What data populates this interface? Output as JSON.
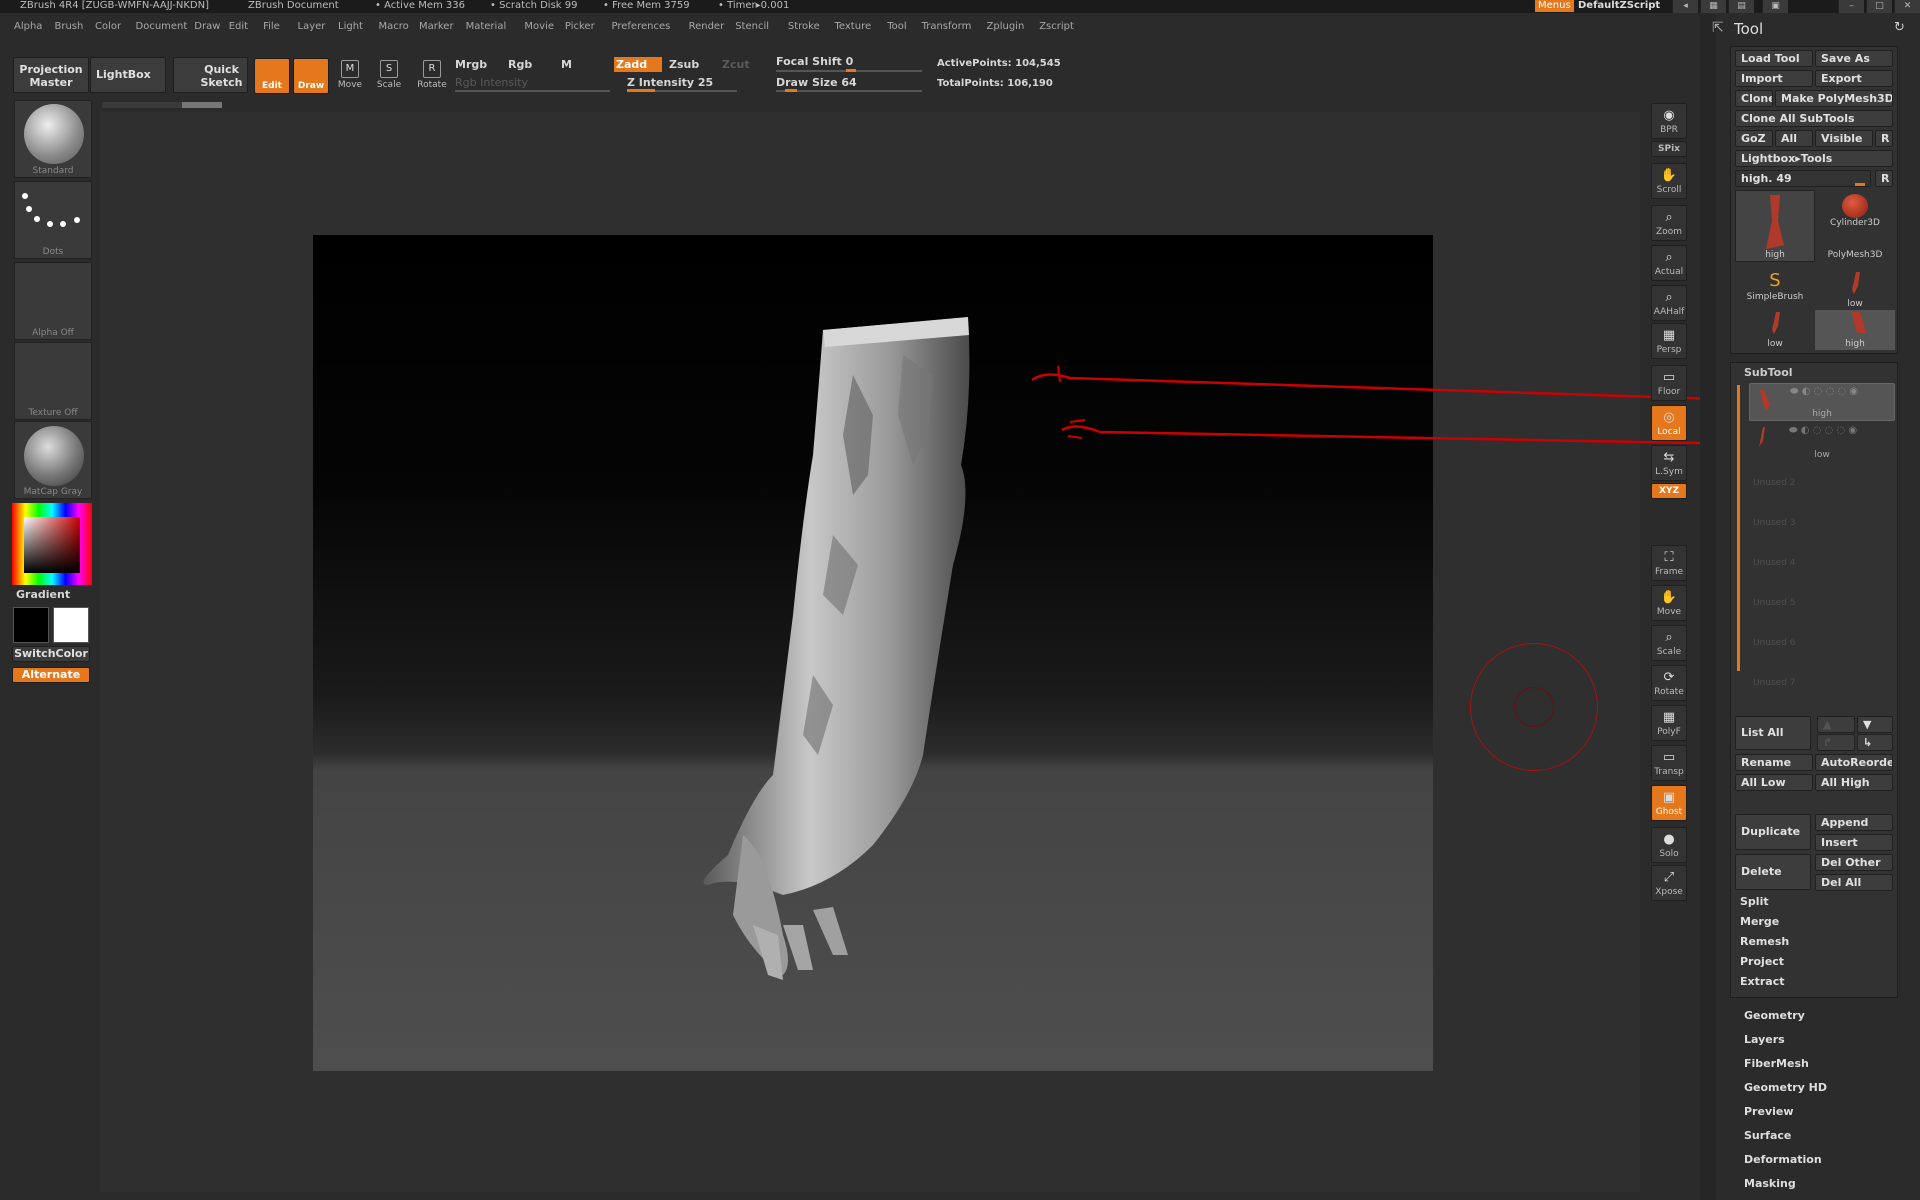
{
  "titlebar": {
    "app": "ZBrush 4R4 [ZUGB-WMFN-AAJJ-NKDN]",
    "document": "ZBrush Document",
    "active_mem": "• Active Mem 336",
    "scratch_disk": "• Scratch Disk 99",
    "free_mem": "• Free Mem 3759",
    "timer": "• Timer▸0.001",
    "menus_btn": "Menus",
    "script": "DefaultZScript"
  },
  "menubar": [
    "Alpha",
    "Brush",
    "Color",
    "Document",
    "Draw",
    "Edit",
    "File",
    "Layer",
    "Light",
    "Macro",
    "Marker",
    "Material",
    "Movie",
    "Picker",
    "Preferences",
    "Render",
    "Stencil",
    "Stroke",
    "Texture",
    "Tool",
    "Transform",
    "Zplugin",
    "Zscript"
  ],
  "shelf": {
    "projection_master": "Projection Master",
    "lightbox": "LightBox",
    "quick_sketch": "Quick Sketch",
    "edit": "Edit",
    "draw": "Draw",
    "move": "Move",
    "scale": "Scale",
    "rotate": "Rotate",
    "mrgb": "Mrgb",
    "rgb": "Rgb",
    "m": "M",
    "zadd": "Zadd",
    "zsub": "Zsub",
    "zcut": "Zcut",
    "rgb_intensity": "Rgb Intensity",
    "z_intensity": "Z Intensity 25",
    "focal_shift": "Focal Shift 0",
    "draw_size": "Draw Size 64",
    "active_points": "ActivePoints: 104,545",
    "total_points": "TotalPoints: 106,190",
    "z_intensity_value": 25,
    "draw_size_value": 64
  },
  "left_tray": {
    "brush": "Standard",
    "stroke": "Dots",
    "alpha": "Alpha Off",
    "texture": "Texture Off",
    "material": "MatCap Gray",
    "gradient": "Gradient",
    "switch_color": "SwitchColor",
    "alternate": "Alternate"
  },
  "right_toolbar": [
    "BPR",
    "SPix",
    "Scroll",
    "Zoom",
    "Actual",
    "AAHalf",
    "Persp",
    "Floor",
    "Local",
    "L.Sym",
    "XYZ",
    "Frame",
    "Move",
    "Scale",
    "Rotate",
    "PolyF",
    "Transp",
    "Ghost",
    "Solo",
    "Xpose"
  ],
  "tool_palette": {
    "title": "Tool",
    "load_tool": "Load Tool",
    "save_as": "Save As",
    "import": "Import",
    "export": "Export",
    "clone": "Clone",
    "make_polymesh": "Make PolyMesh3D",
    "clone_all": "Clone  All SubTools",
    "goz": "GoZ",
    "all": "All",
    "visible": "Visible",
    "r": "R",
    "lightbox_tools": "Lightbox▸Tools",
    "high_slider": "high. 49",
    "thumbs": [
      "high",
      "Cylinder3D",
      "PolyMesh3D",
      "SimpleBrush",
      "low",
      "low",
      "high"
    ]
  },
  "subtool": {
    "title": "SubTool",
    "items": [
      "high",
      "low"
    ],
    "unused": [
      "Unused 2",
      "Unused 3",
      "Unused 4",
      "Unused 5",
      "Unused 6",
      "Unused 7"
    ],
    "list_all": "List  All",
    "rename": "Rename",
    "autoreorder": "AutoReorder",
    "all_low": "All Low",
    "all_high": "All High",
    "duplicate": "Duplicate",
    "append": "Append",
    "insert": "Insert",
    "delete": "Delete",
    "del_other": "Del Other",
    "del_all": "Del All",
    "split": "Split",
    "merge": "Merge",
    "remesh": "Remesh",
    "project": "Project",
    "extract": "Extract"
  },
  "sections": [
    "Geometry",
    "Layers",
    "FiberMesh",
    "Geometry HD",
    "Preview",
    "Surface",
    "Deformation",
    "Masking"
  ],
  "colors": {
    "accent": "#e5771d",
    "annotation": "#cc0000",
    "panel": "#2b2b2b"
  }
}
